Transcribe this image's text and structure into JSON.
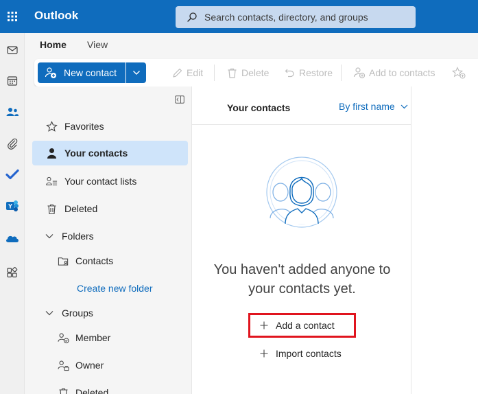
{
  "app": {
    "title": "Outlook"
  },
  "search": {
    "placeholder": "Search contacts, directory, and groups"
  },
  "rail": {
    "icons": [
      "mail-icon",
      "calendar-icon",
      "people-icon",
      "attachment-icon",
      "todo-icon",
      "yammer-icon",
      "onedrive-icon",
      "apps-icon"
    ]
  },
  "ribbon": {
    "tabs": [
      {
        "label": "Home",
        "active": true
      },
      {
        "label": "View",
        "active": false
      }
    ],
    "new_contact": "New contact",
    "edit": "Edit",
    "delete": "Delete",
    "restore": "Restore",
    "add_to_contacts": "Add to contacts"
  },
  "nav": {
    "favorites": "Favorites",
    "your_contacts": "Your contacts",
    "your_contact_lists": "Your contact lists",
    "deleted": "Deleted",
    "folders": "Folders",
    "contacts": "Contacts",
    "create_new_folder": "Create new folder",
    "groups": "Groups",
    "member": "Member",
    "owner": "Owner",
    "groups_deleted": "Deleted"
  },
  "list": {
    "title": "Your contacts",
    "sort_label": "By first name",
    "empty_message": "You haven't added anyone to your contacts yet.",
    "add_contact": "Add a contact",
    "import_contacts": "Import contacts"
  },
  "colors": {
    "brand": "#0f6cbd",
    "selected": "#cfe4fa",
    "highlight_box": "#e0141e",
    "disabled": "#bdbdbd"
  }
}
